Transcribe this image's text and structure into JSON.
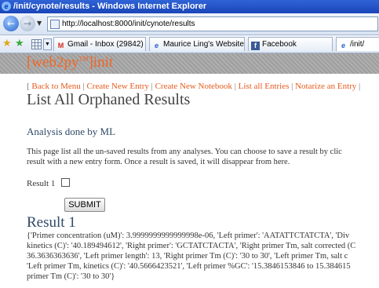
{
  "window": {
    "title": "/init/cynote/results - Windows Internet Explorer"
  },
  "address": {
    "url": "http://localhost:8000/init/cynote/results"
  },
  "tabs": [
    {
      "label": "Gmail - Inbox (29842) - ...",
      "icon": "gmail-icon"
    },
    {
      "label": "Maurice Ling's Website",
      "icon": "ie-page-icon"
    },
    {
      "label": "Facebook",
      "icon": "facebook-icon"
    },
    {
      "label": "/init/",
      "icon": "ie-page-icon"
    }
  ],
  "header": {
    "brand_prefix": "[web2py",
    "brand_tm": "TM",
    "brand_suffix": "]init"
  },
  "menu": {
    "open": "[ ",
    "items": [
      "Back to Menu",
      "Create New Entry",
      "Create New Notebook",
      "List all Entries",
      "Notarize an Entry"
    ],
    "separator": " | "
  },
  "page": {
    "title": "List All Orphaned Results",
    "subtitle": "Analysis done by ML",
    "desc_line1": "This page list all the un-saved results from any analyses. You can choose to save a result by clic",
    "desc_line2": "result with a new entry form. Once a result is saved, it will disappear from here."
  },
  "form": {
    "checkbox_label": "Result 1",
    "submit_label": "SUBMIT"
  },
  "result": {
    "title": "Result 1",
    "lines": [
      "{'Primer concentration (uM)': 3.9999999999999998e-06, 'Left primer': 'AATATTCTATCTA', 'Div",
      "kinetics (C)': '40.189494612', 'Right primer': 'GCTATCTACTA', 'Right primer Tm, salt corrected (C",
      "36.3636363636', 'Left primer length': 13, 'Right primer Tm (C)': '30 to 30', 'Left primer Tm, salt c",
      "'Left primer Tm, kinetics (C)': '40.5666423521', 'Left primer %GC': '15.3846153846 to 15.384615",
      "primer Tm (C)': '30 to 30'}"
    ]
  }
}
